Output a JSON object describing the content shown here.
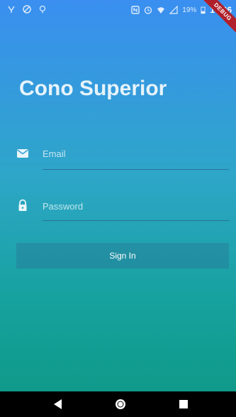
{
  "status_bar": {
    "battery": "19%",
    "time": "14:06"
  },
  "debug_banner": "DEBUG",
  "title": "Cono Superior",
  "email": {
    "placeholder": "Email",
    "value": ""
  },
  "password": {
    "placeholder": "Password",
    "value": ""
  },
  "signin_label": "Sign In",
  "icons": [
    "mail-icon",
    "lock-icon",
    "back-icon",
    "home-icon",
    "recents-icon"
  ],
  "colors": {
    "gradient_top": "#3a8ff0",
    "gradient_bottom": "#0f9a8a",
    "debug_ribbon": "#b0202a"
  }
}
